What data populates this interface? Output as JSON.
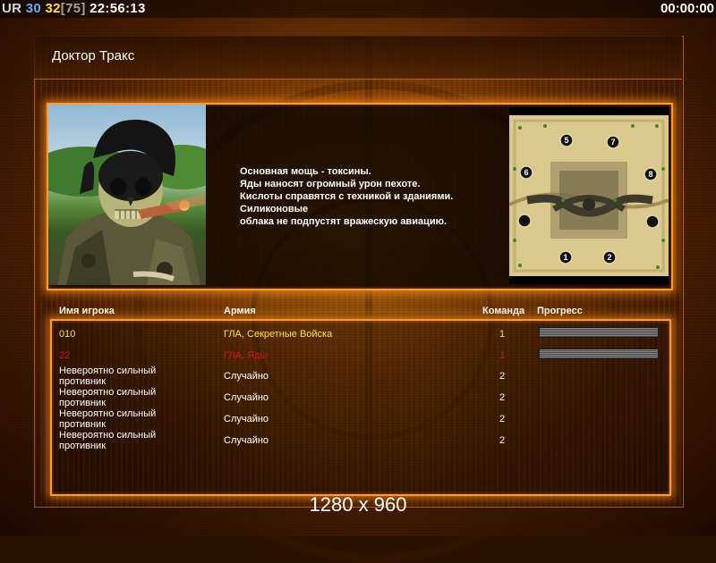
{
  "hud": {
    "ur_label": "UR",
    "fps": "30",
    "current": "32",
    "max": "[75]",
    "clock": "22:56:13",
    "timer": "00:00:00"
  },
  "title": "Доктор Тракс",
  "description": [
    "Основная мощь - токсины.",
    "Яды наносят огромный урон пехоте.",
    "Кислоты справятся с техникой и зданиями.",
    "Силиконовые",
    "облака не подпустят вражескую авиацию."
  ],
  "minimap": {
    "slots": [
      "5",
      "7",
      "6",
      "8",
      "",
      "",
      "1",
      "2"
    ]
  },
  "table": {
    "headers": {
      "name": "Имя игрока",
      "army": "Армия",
      "team": "Команда",
      "progress": "Прогресс"
    },
    "players": [
      {
        "name": "010",
        "army": "ГЛА, Секретные Войска",
        "team": "1",
        "color": "#ffe14a",
        "progress": 1.0
      },
      {
        "name": "22",
        "army": "ГЛА, Яды",
        "team": "1",
        "color": "#e01010",
        "progress": 1.0
      },
      {
        "name": "Невероятно сильный противник",
        "army": "Случайно",
        "team": "2",
        "color": "#ffffff"
      },
      {
        "name": "Невероятно сильный противник",
        "army": "Случайно",
        "team": "2",
        "color": "#ffffff"
      },
      {
        "name": "Невероятно сильный противник",
        "army": "Случайно",
        "team": "2",
        "color": "#ffffff"
      },
      {
        "name": "Невероятно сильный противник",
        "army": "Случайно",
        "team": "2",
        "color": "#ffffff"
      }
    ]
  },
  "resolution": "1280 x 960",
  "colors": {
    "accent": "#ff9a2a",
    "player_yellow": "#ffe14a",
    "player_red": "#e01010"
  }
}
